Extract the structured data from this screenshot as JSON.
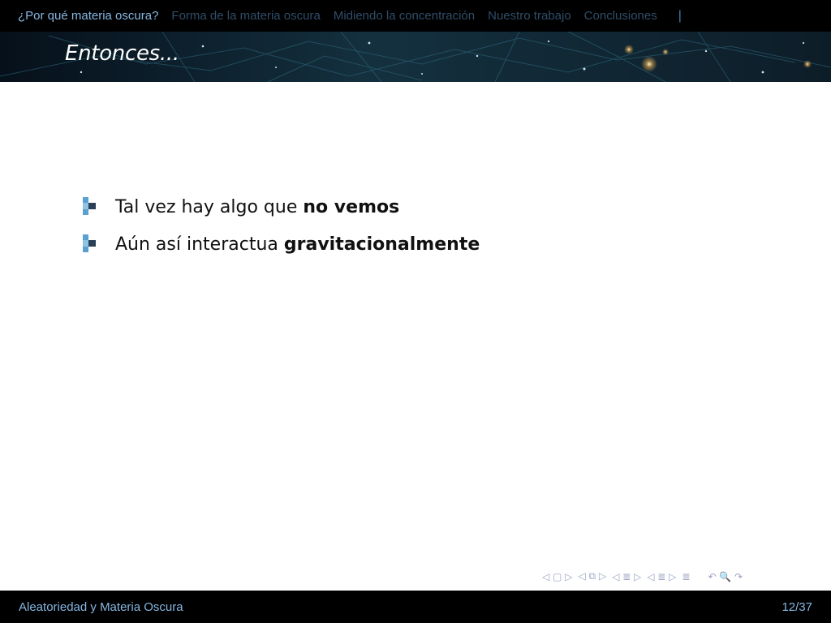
{
  "nav": {
    "sections": [
      {
        "label": "¿Por qué materia oscura?",
        "active": true
      },
      {
        "label": "Forma de la materia oscura",
        "active": false
      },
      {
        "label": "Midiendo la concentración",
        "active": false
      },
      {
        "label": "Nuestro trabajo",
        "active": false
      },
      {
        "label": "Conclusiones",
        "active": false
      }
    ],
    "progress_marker": "|"
  },
  "frame": {
    "title": "Entonces..."
  },
  "bullets": [
    {
      "plain": "Tal vez hay algo que ",
      "bold": "no vemos"
    },
    {
      "plain": "Aún así interactua ",
      "bold": "gravitacionalmente"
    }
  ],
  "navigation_symbols": {
    "slide": "◁ ▢ ▷",
    "frame": "◁ ⧉ ▷",
    "subsection": "◁ ≣ ▷",
    "section": "◁ ≣ ▷",
    "document": "≣",
    "search": "↶ 🔍 ↷"
  },
  "footer": {
    "title": "Aleatoriedad y Materia Oscura",
    "page": "12/37"
  },
  "colors": {
    "active_nav": "#86b7e2",
    "inactive_nav": "#2f4d68",
    "bar_background": "#000000",
    "bullet_dark": "#2a4057",
    "bullet_light": "#5aa0d0"
  }
}
